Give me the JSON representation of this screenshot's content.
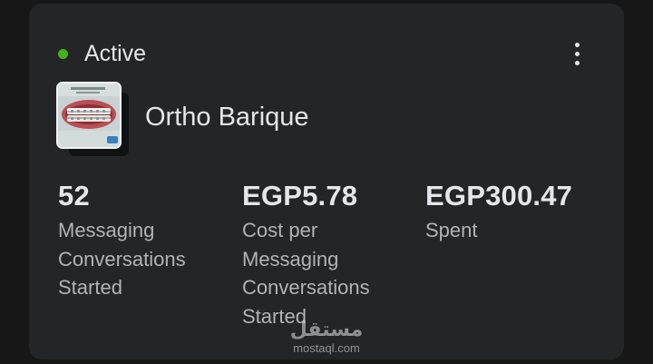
{
  "status": {
    "label": "Active",
    "color": "#44b21a"
  },
  "menu": {
    "icon": "more-vertical-icon"
  },
  "campaign": {
    "name": "Ortho Barique",
    "thumbnail": "campaign-thumbnail-image"
  },
  "metrics": [
    {
      "value": "52",
      "label": "Messaging Conversations Started"
    },
    {
      "value": "EGP5.78",
      "label": "Cost per Messaging Conversations Started"
    },
    {
      "value": "EGP300.47",
      "label": "Spent"
    }
  ],
  "watermark": {
    "arabic": "مستقل",
    "latin": "mostaql.com"
  }
}
